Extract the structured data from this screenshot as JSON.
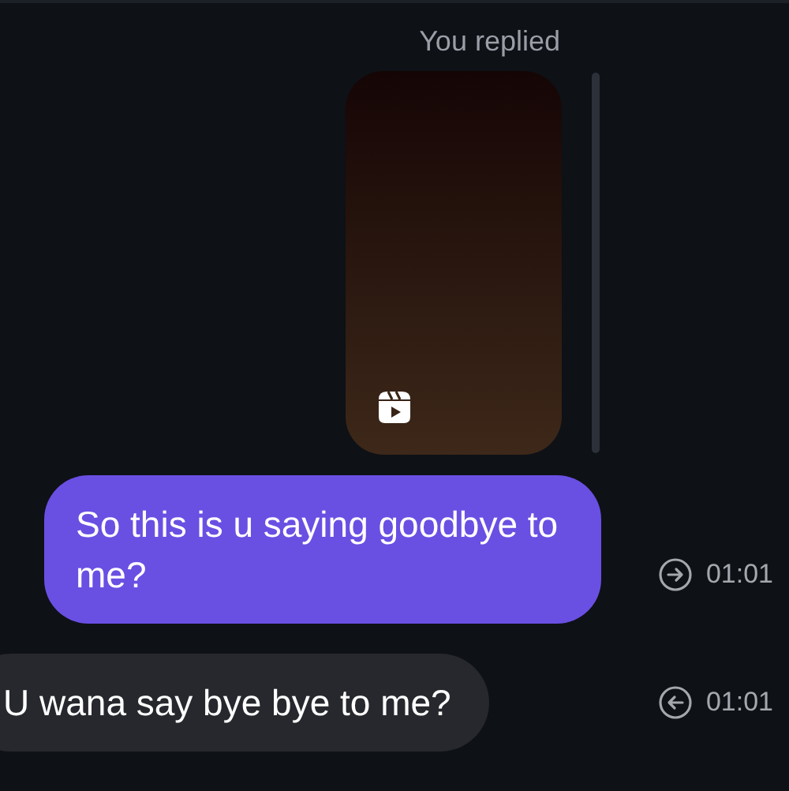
{
  "reply_label": "You replied",
  "reply_preview": {
    "kind": "reel"
  },
  "messages": [
    {
      "kind": "sent",
      "text": "So this is u saying goodbye to me?",
      "time": "01:01"
    },
    {
      "kind": "received",
      "text": "U wana say bye bye to me?",
      "time": "01:01"
    }
  ]
}
